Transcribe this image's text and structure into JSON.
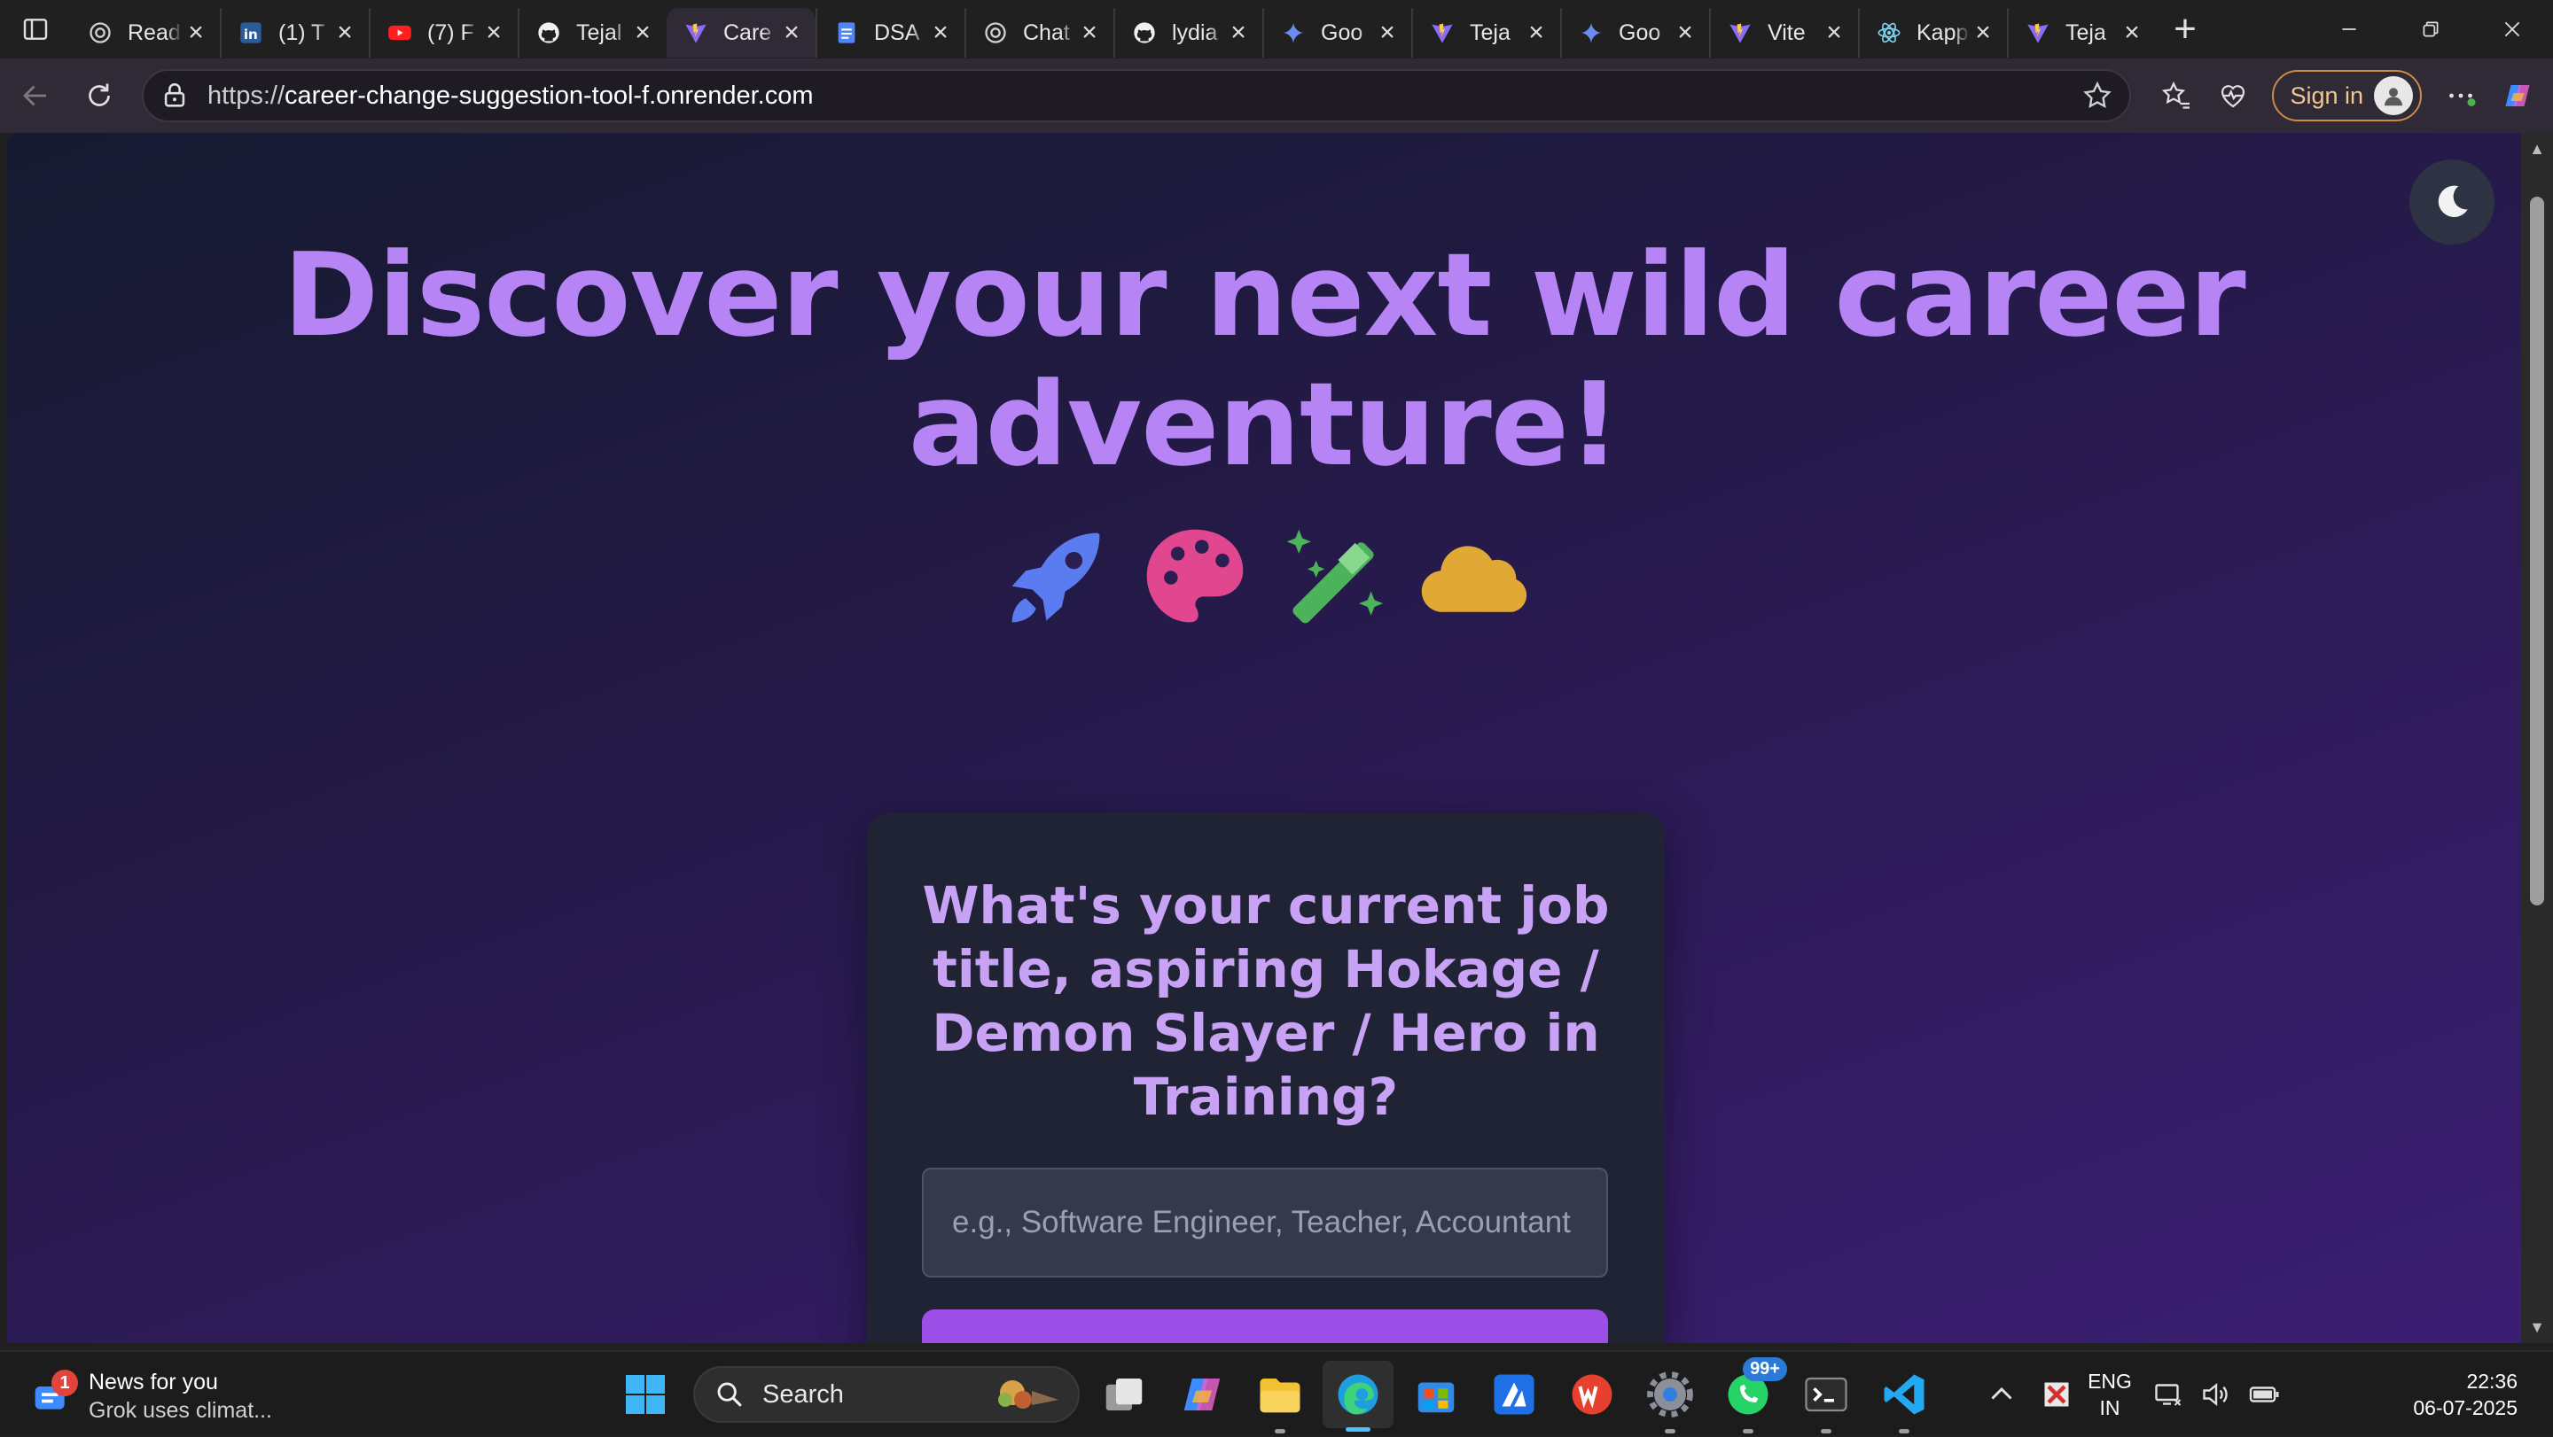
{
  "browser": {
    "tabs": [
      {
        "title": "Read",
        "icon": "openai-icon"
      },
      {
        "title": "(1) T",
        "icon": "linkedin-icon"
      },
      {
        "title": "(7) F",
        "icon": "youtube-icon"
      },
      {
        "title": "Tejal",
        "icon": "github-icon"
      },
      {
        "title": "Care",
        "icon": "vite-icon",
        "active": true
      },
      {
        "title": "DSA",
        "icon": "docs-icon"
      },
      {
        "title": "Chat",
        "icon": "openai-icon"
      },
      {
        "title": "lydia",
        "icon": "github-icon"
      },
      {
        "title": "Goo",
        "icon": "gemini-icon"
      },
      {
        "title": "Teja",
        "icon": "vite-icon"
      },
      {
        "title": "Goo",
        "icon": "gemini-icon"
      },
      {
        "title": "Vite",
        "icon": "vite-icon"
      },
      {
        "title": "Kapp",
        "icon": "react-icon"
      },
      {
        "title": "Teja",
        "icon": "vite-icon"
      }
    ],
    "url_scheme": "https://",
    "url_host": "career-change-suggestion-tool-f.onrender.com",
    "signin_label": "Sign in"
  },
  "page": {
    "hero_title": "Discover your next wild career adventure!",
    "hero_icons": [
      "rocket-icon",
      "palette-icon",
      "magic-wand-icon",
      "cloud-icon"
    ],
    "question": "What's your current job title, aspiring Hokage / Demon Slayer / Hero in Training?",
    "input_placeholder": "e.g., Software Engineer, Teacher, Accountant",
    "input_value": ""
  },
  "taskbar": {
    "news_title": "News for you",
    "news_subtitle": "Grok uses climat...",
    "news_badge": "1",
    "search_label": "Search",
    "whatsapp_badge": "99+",
    "lang_line1": "ENG",
    "lang_line2": "IN",
    "time": "22:36",
    "date": "06-07-2025"
  },
  "colors": {
    "hero_text": "#b784f5",
    "question_text": "#c8a2f5",
    "accent_button": "#9b4fe6",
    "card_bg": "#1f2333"
  }
}
